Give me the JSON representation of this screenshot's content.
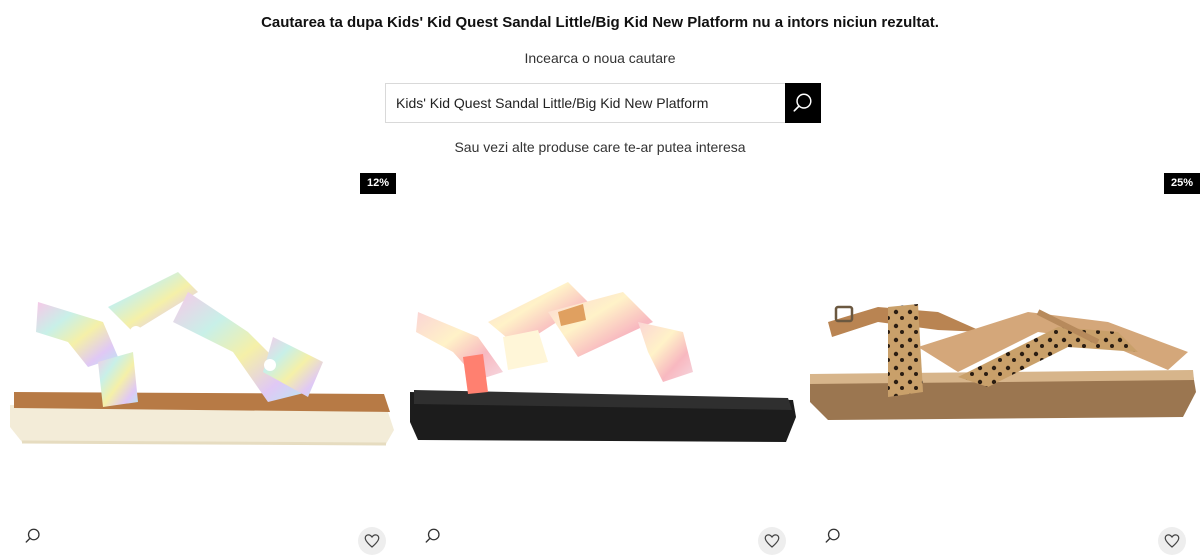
{
  "search": {
    "result_message": "Cautarea ta dupa Kids' Kid Quest Sandal Little/Big Kid New Platform nu a intors niciun rezultat.",
    "try_again": "Incearca o noua cautare",
    "query": "Kids' Kid Quest Sandal Little/Big Kid New Platform",
    "search_icon": "search-icon"
  },
  "suggestions": {
    "label": "Sau vezi alte produse care te-ar putea interesa"
  },
  "products": [
    {
      "discount": "12%",
      "quick_view_icon": "magnifier-icon",
      "wishlist_icon": "heart-icon"
    },
    {
      "discount": "",
      "quick_view_icon": "magnifier-icon",
      "wishlist_icon": "heart-icon"
    },
    {
      "discount": "25%",
      "quick_view_icon": "magnifier-icon",
      "wishlist_icon": "heart-icon"
    }
  ],
  "colors": {
    "badge_bg": "#000000",
    "search_button_bg": "#000000"
  }
}
